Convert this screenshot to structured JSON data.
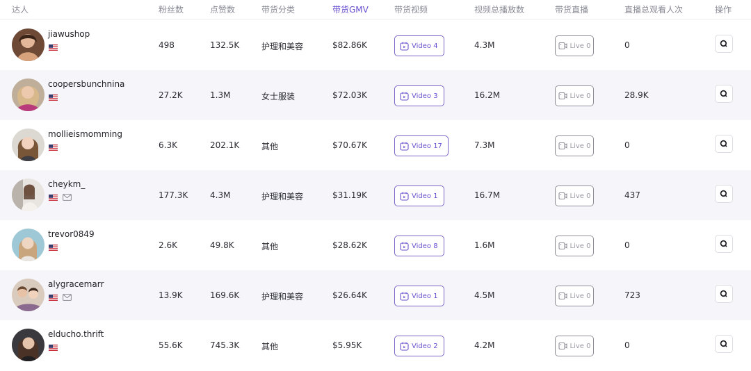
{
  "header": {
    "creator": "达人",
    "followers": "粉丝数",
    "likes": "点赞数",
    "category": "带货分类",
    "gmv": "带货GMV",
    "videos": "带货视频",
    "video_views": "视频总播放数",
    "lives": "带货直播",
    "live_viewers": "直播总观看人次",
    "action": "操作"
  },
  "colors": {
    "accent": "#6a4fd0",
    "alt_row": "#f6f6fa",
    "live_border": "#8f8f99"
  },
  "rows": [
    {
      "name": "jiawushop",
      "flag_icon": "us-flag-icon",
      "has_mail": false,
      "followers": "498",
      "likes": "132.5K",
      "category": "护理和美容",
      "gmv": "$82.86K",
      "video_label": "Video 4",
      "views": "4.3M",
      "live_label": "Live 0",
      "live_viewers": "0"
    },
    {
      "name": "coopersbunchnina",
      "flag_icon": "us-flag-icon",
      "has_mail": false,
      "followers": "27.2K",
      "likes": "1.3M",
      "category": "女士服装",
      "gmv": "$72.03K",
      "video_label": "Video 3",
      "views": "16.2M",
      "live_label": "Live 0",
      "live_viewers": "28.9K"
    },
    {
      "name": "mollieismomming",
      "flag_icon": "us-flag-icon",
      "has_mail": false,
      "followers": "6.3K",
      "likes": "202.1K",
      "category": "其他",
      "gmv": "$70.67K",
      "video_label": "Video 17",
      "views": "7.3M",
      "live_label": "Live 0",
      "live_viewers": "0"
    },
    {
      "name": "cheykm_",
      "flag_icon": "us-flag-icon",
      "has_mail": true,
      "followers": "177.3K",
      "likes": "4.3M",
      "category": "护理和美容",
      "gmv": "$31.19K",
      "video_label": "Video 1",
      "views": "16.7M",
      "live_label": "Live 0",
      "live_viewers": "437"
    },
    {
      "name": "trevor0849",
      "flag_icon": "us-flag-icon",
      "has_mail": false,
      "followers": "2.6K",
      "likes": "49.8K",
      "category": "其他",
      "gmv": "$28.62K",
      "video_label": "Video 8",
      "views": "1.6M",
      "live_label": "Live 0",
      "live_viewers": "0"
    },
    {
      "name": "alygracemarr",
      "flag_icon": "us-flag-icon",
      "has_mail": true,
      "followers": "13.9K",
      "likes": "169.6K",
      "category": "护理和美容",
      "gmv": "$26.64K",
      "video_label": "Video 1",
      "views": "4.5M",
      "live_label": "Live 0",
      "live_viewers": "723"
    },
    {
      "name": "elducho.thrift",
      "flag_icon": "us-flag-icon",
      "has_mail": false,
      "followers": "55.6K",
      "likes": "745.3K",
      "category": "其他",
      "gmv": "$5.95K",
      "video_label": "Video 2",
      "views": "4.2M",
      "live_label": "Live 0",
      "live_viewers": "0"
    }
  ]
}
